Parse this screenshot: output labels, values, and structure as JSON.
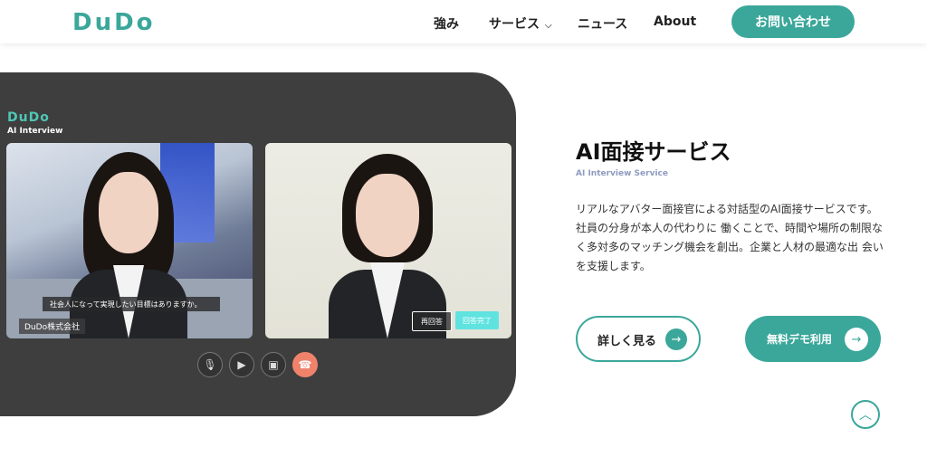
{
  "header": {
    "logo": "DuDo",
    "nav": {
      "strengths": "強み",
      "service": "サービス",
      "news": "ニュース",
      "about": "About"
    },
    "contact_button": "お問い合わせ"
  },
  "demo": {
    "logo": "DuDo",
    "sub": "AI Interview",
    "subtitle_caption": "社会人になって実現したい目標はありますか。",
    "company_label": "DuDo株式会社",
    "reanswer_button": "再回答",
    "complete_button": "回答完了",
    "controls": [
      "mic-icon",
      "camera-icon",
      "screen-icon",
      "hangup-icon"
    ]
  },
  "content": {
    "title": "AI面接サービス",
    "subtitle": "AI Interview Service",
    "description": "リアルなアバター面接官による対話型のAI面接サービスです。社員の分身が本人の代わりに 働くことで、時間や場所の制限なく多対多のマッチング機会を創出。企業と人材の最適な出 会いを支援します。",
    "detail_button": "詳しく見る",
    "demo_button": "無料デモ利用"
  },
  "colors": {
    "brand": "#3aa79a",
    "panel": "#3e3e3e",
    "accent_cyan": "#5ee3e0",
    "hangup": "#f0826c"
  }
}
